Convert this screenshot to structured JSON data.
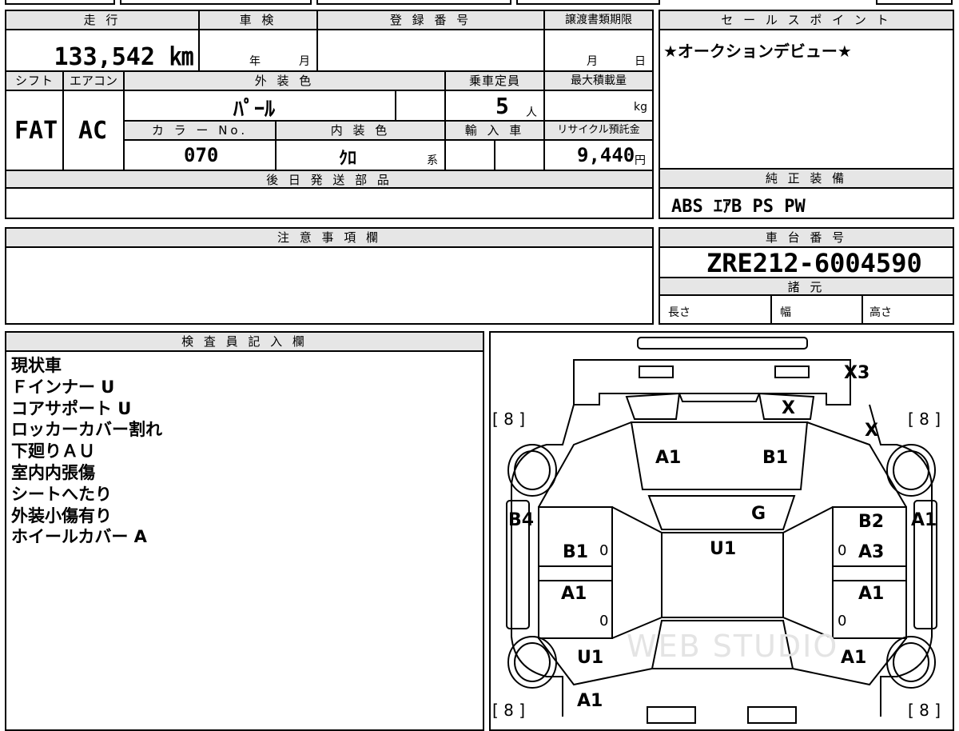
{
  "sheet": {
    "mileage": {
      "label": "走 行",
      "value": "133,542 ㎞"
    },
    "shaken": {
      "label": "車 検",
      "year_label": "年",
      "month_label": "月"
    },
    "registration": {
      "label": "登 録 番 号",
      "value": ""
    },
    "transfer_deadline": {
      "label": "譲渡書類期限",
      "month_label": "月",
      "day_label": "日"
    },
    "sales_point": {
      "label": "セ ー ル ス ポ イ ン ト",
      "text": "★オークションデビュー★"
    },
    "shift": {
      "label": "シフト",
      "value": "FAT"
    },
    "aircon": {
      "label": "エアコン",
      "value": "AC"
    },
    "exterior_color": {
      "label": "外 装 色",
      "value": "ﾊﾟｰﾙ"
    },
    "capacity": {
      "label": "乗車定員",
      "value": "5",
      "unit": "人"
    },
    "max_load": {
      "label": "最大積載量",
      "unit": "kg"
    },
    "color_no": {
      "label": "カ ラ ー No.",
      "value": "070"
    },
    "interior_color": {
      "label": "内 装 色",
      "value": "ｸﾛ",
      "unit": "系"
    },
    "import": {
      "label": "輸 入 車"
    },
    "recycle": {
      "label": "リサイクル預託金",
      "value": "9,440",
      "unit": "円"
    },
    "later_parts": {
      "label": "後 日 発 送 部 品"
    },
    "genuine_equipment": {
      "label": "純 正 装 備",
      "value": "ABS ｴｱB PS PW"
    },
    "notes": {
      "label": "注 意 事 項 欄"
    },
    "chassis": {
      "label": "車 台 番 号",
      "value": "ZRE212-6004590"
    },
    "specs": {
      "label": "諸 元",
      "length": "長さ",
      "width": "幅",
      "height": "高さ"
    },
    "inspector": {
      "label": "検 査 員 記 入 欄",
      "lines": [
        "現状車",
        "Ｆインナー U",
        "コアサポート U",
        "ロッカーカバー割れ",
        "下廻りＡＵ",
        "室内内張傷",
        "シートへたり",
        "外装小傷有り",
        "ホイールカバー A"
      ]
    },
    "diagram": {
      "tire_fl": "[ 8 ]",
      "tire_fr": "[ 8 ]",
      "tire_rl": "[ 8 ]",
      "tire_rr": "[ 8 ]",
      "bumper": "X3",
      "grille_x": "X",
      "fender_x": "X",
      "hood_left": "A1",
      "hood_right": "B1",
      "windshield": "G",
      "roof": "U1",
      "fender_left": "B4",
      "door_fl": "B1",
      "door_rl": "A1",
      "rear_left": "U1",
      "rear_bottom_left": "A1",
      "door_fr": "B2",
      "door_fr2": "A3",
      "fender_right": "A1",
      "door_rr": "A1",
      "rear_right": "A1",
      "zero1": "0",
      "zero2": "0",
      "zero3": "0",
      "zero4": "0",
      "watermark": "WEB STUDIO"
    }
  }
}
